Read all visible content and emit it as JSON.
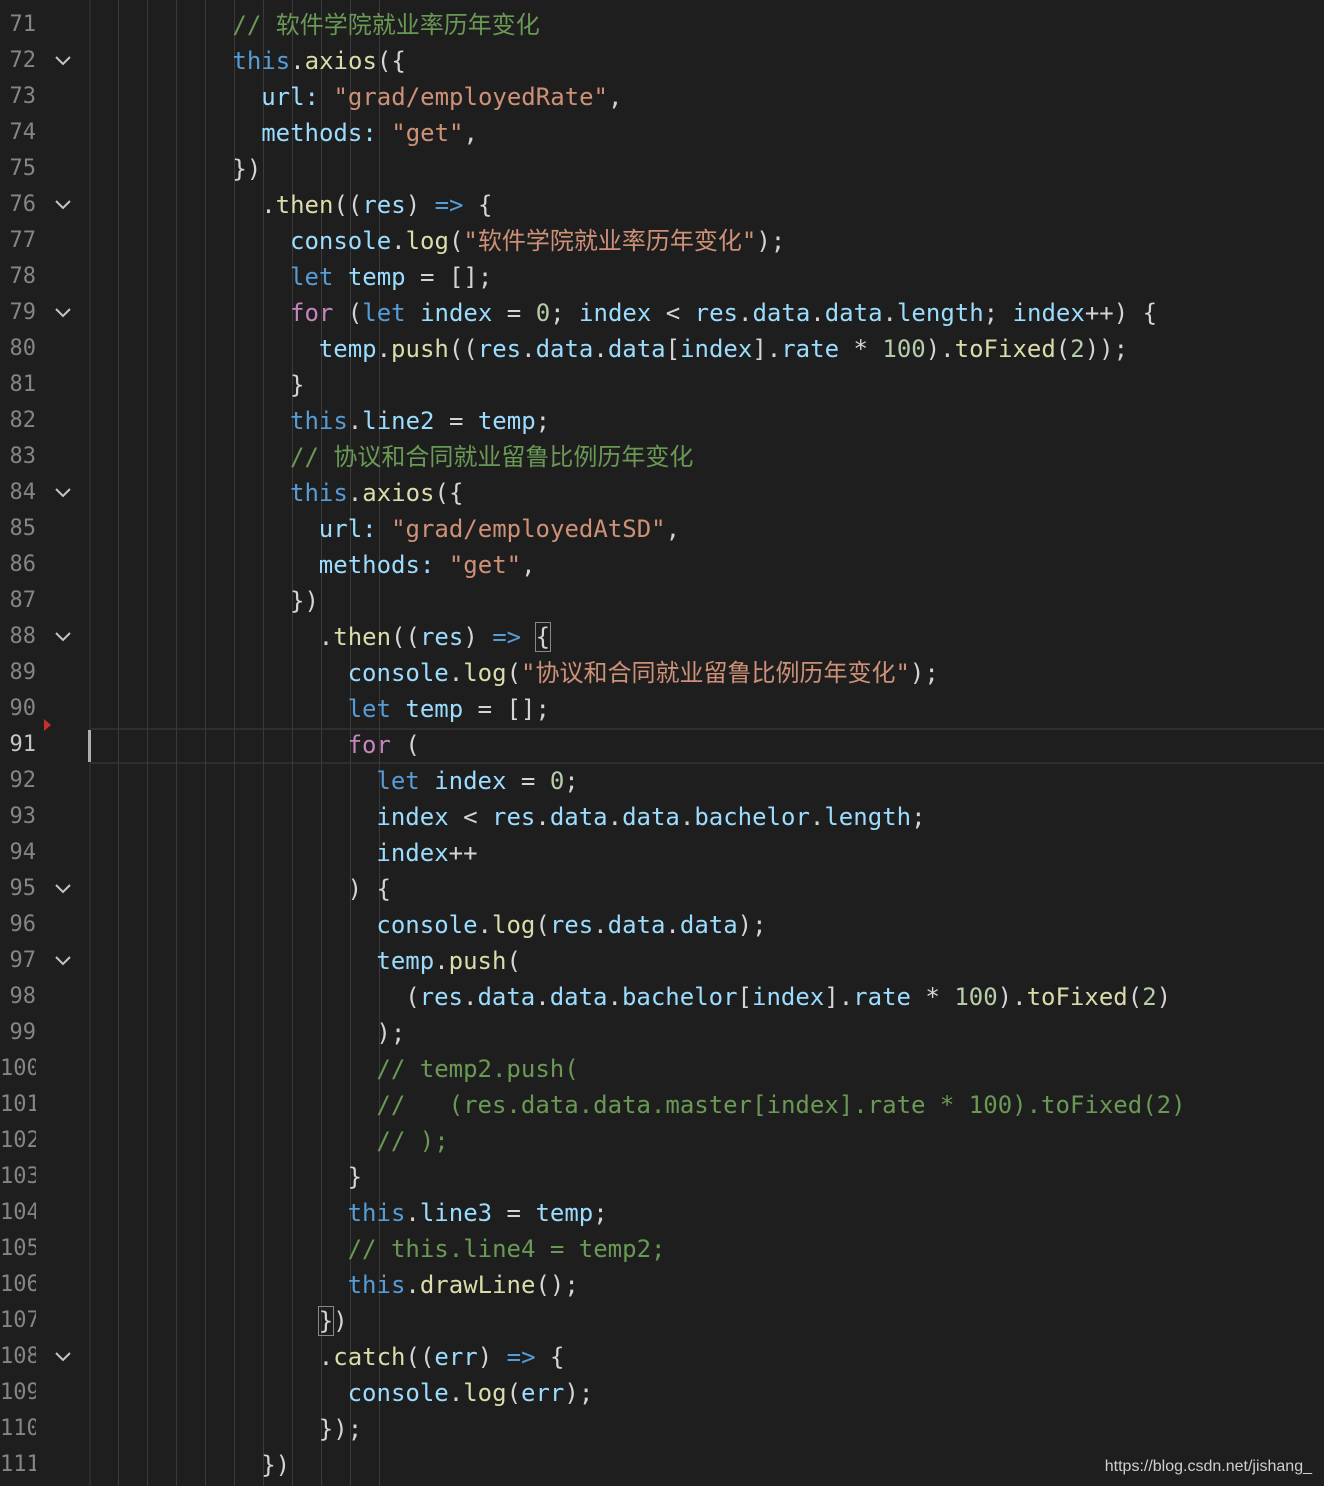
{
  "editor": {
    "active_line": "91",
    "lines": [
      {
        "number": "71",
        "fold": false,
        "indent": 8,
        "tokens": [
          {
            "t": "cmt",
            "v": "// 软件学院就业率历年变化"
          }
        ]
      },
      {
        "number": "72",
        "fold": true,
        "indent": 8,
        "tokens": [
          {
            "t": "kw",
            "v": "this"
          },
          {
            "t": "pun",
            "v": "."
          },
          {
            "t": "fn",
            "v": "axios"
          },
          {
            "t": "pun",
            "v": "({"
          }
        ]
      },
      {
        "number": "73",
        "fold": false,
        "indent": 9,
        "tokens": [
          {
            "t": "var",
            "v": "url"
          },
          {
            "t": "var",
            "v": ":"
          },
          {
            "t": "pun",
            "v": " "
          },
          {
            "t": "str",
            "v": "\"grad/employedRate\""
          },
          {
            "t": "pun",
            "v": ","
          }
        ]
      },
      {
        "number": "74",
        "fold": false,
        "indent": 9,
        "tokens": [
          {
            "t": "var",
            "v": "methods"
          },
          {
            "t": "var",
            "v": ":"
          },
          {
            "t": "pun",
            "v": " "
          },
          {
            "t": "str",
            "v": "\"get\""
          },
          {
            "t": "pun",
            "v": ","
          }
        ]
      },
      {
        "number": "75",
        "fold": false,
        "indent": 8,
        "tokens": [
          {
            "t": "pun",
            "v": "})"
          }
        ]
      },
      {
        "number": "76",
        "fold": true,
        "indent": 9,
        "tokens": [
          {
            "t": "pun",
            "v": "."
          },
          {
            "t": "fn",
            "v": "then"
          },
          {
            "t": "pun",
            "v": "(("
          },
          {
            "t": "var",
            "v": "res"
          },
          {
            "t": "pun",
            "v": ") "
          },
          {
            "t": "kw",
            "v": "=>"
          },
          {
            "t": "pun",
            "v": " {"
          }
        ]
      },
      {
        "number": "77",
        "fold": false,
        "indent": 10,
        "tokens": [
          {
            "t": "var",
            "v": "console"
          },
          {
            "t": "pun",
            "v": "."
          },
          {
            "t": "fn",
            "v": "log"
          },
          {
            "t": "pun",
            "v": "("
          },
          {
            "t": "str",
            "v": "\"软件学院就业率历年变化\""
          },
          {
            "t": "pun",
            "v": ");"
          }
        ]
      },
      {
        "number": "78",
        "fold": false,
        "indent": 10,
        "tokens": [
          {
            "t": "kw",
            "v": "let"
          },
          {
            "t": "pun",
            "v": " "
          },
          {
            "t": "var",
            "v": "temp"
          },
          {
            "t": "pun",
            "v": " = [];"
          }
        ]
      },
      {
        "number": "79",
        "fold": true,
        "indent": 10,
        "tokens": [
          {
            "t": "ctl",
            "v": "for"
          },
          {
            "t": "pun",
            "v": " ("
          },
          {
            "t": "kw",
            "v": "let"
          },
          {
            "t": "pun",
            "v": " "
          },
          {
            "t": "var",
            "v": "index"
          },
          {
            "t": "pun",
            "v": " = "
          },
          {
            "t": "num",
            "v": "0"
          },
          {
            "t": "pun",
            "v": "; "
          },
          {
            "t": "var",
            "v": "index"
          },
          {
            "t": "pun",
            "v": " < "
          },
          {
            "t": "var",
            "v": "res"
          },
          {
            "t": "pun",
            "v": "."
          },
          {
            "t": "var",
            "v": "data"
          },
          {
            "t": "pun",
            "v": "."
          },
          {
            "t": "var",
            "v": "data"
          },
          {
            "t": "pun",
            "v": "."
          },
          {
            "t": "var",
            "v": "length"
          },
          {
            "t": "pun",
            "v": "; "
          },
          {
            "t": "var",
            "v": "index"
          },
          {
            "t": "pun",
            "v": "++) {"
          }
        ]
      },
      {
        "number": "80",
        "fold": false,
        "indent": 11,
        "tokens": [
          {
            "t": "var",
            "v": "temp"
          },
          {
            "t": "pun",
            "v": "."
          },
          {
            "t": "fn",
            "v": "push"
          },
          {
            "t": "pun",
            "v": "(("
          },
          {
            "t": "var",
            "v": "res"
          },
          {
            "t": "pun",
            "v": "."
          },
          {
            "t": "var",
            "v": "data"
          },
          {
            "t": "pun",
            "v": "."
          },
          {
            "t": "var",
            "v": "data"
          },
          {
            "t": "pun",
            "v": "["
          },
          {
            "t": "var",
            "v": "index"
          },
          {
            "t": "pun",
            "v": "]."
          },
          {
            "t": "var",
            "v": "rate"
          },
          {
            "t": "pun",
            "v": " * "
          },
          {
            "t": "num",
            "v": "100"
          },
          {
            "t": "pun",
            "v": ")."
          },
          {
            "t": "fn",
            "v": "toFixed"
          },
          {
            "t": "pun",
            "v": "("
          },
          {
            "t": "num",
            "v": "2"
          },
          {
            "t": "pun",
            "v": "));"
          }
        ]
      },
      {
        "number": "81",
        "fold": false,
        "indent": 10,
        "tokens": [
          {
            "t": "pun",
            "v": "}"
          }
        ]
      },
      {
        "number": "82",
        "fold": false,
        "indent": 10,
        "tokens": [
          {
            "t": "kw",
            "v": "this"
          },
          {
            "t": "pun",
            "v": "."
          },
          {
            "t": "var",
            "v": "line2"
          },
          {
            "t": "pun",
            "v": " = "
          },
          {
            "t": "var",
            "v": "temp"
          },
          {
            "t": "pun",
            "v": ";"
          }
        ]
      },
      {
        "number": "83",
        "fold": false,
        "indent": 10,
        "tokens": [
          {
            "t": "cmt",
            "v": "// 协议和合同就业留鲁比例历年变化"
          }
        ]
      },
      {
        "number": "84",
        "fold": true,
        "indent": 10,
        "tokens": [
          {
            "t": "kw",
            "v": "this"
          },
          {
            "t": "pun",
            "v": "."
          },
          {
            "t": "fn",
            "v": "axios"
          },
          {
            "t": "pun",
            "v": "({"
          }
        ]
      },
      {
        "number": "85",
        "fold": false,
        "indent": 11,
        "tokens": [
          {
            "t": "var",
            "v": "url"
          },
          {
            "t": "var",
            "v": ":"
          },
          {
            "t": "pun",
            "v": " "
          },
          {
            "t": "str",
            "v": "\"grad/employedAtSD\""
          },
          {
            "t": "pun",
            "v": ","
          }
        ]
      },
      {
        "number": "86",
        "fold": false,
        "indent": 11,
        "tokens": [
          {
            "t": "var",
            "v": "methods"
          },
          {
            "t": "var",
            "v": ":"
          },
          {
            "t": "pun",
            "v": " "
          },
          {
            "t": "str",
            "v": "\"get\""
          },
          {
            "t": "pun",
            "v": ","
          }
        ]
      },
      {
        "number": "87",
        "fold": false,
        "indent": 10,
        "tokens": [
          {
            "t": "pun",
            "v": "})"
          }
        ]
      },
      {
        "number": "88",
        "fold": true,
        "indent": 11,
        "tokens": [
          {
            "t": "pun",
            "v": "."
          },
          {
            "t": "fn",
            "v": "then"
          },
          {
            "t": "pun",
            "v": "(("
          },
          {
            "t": "var",
            "v": "res"
          },
          {
            "t": "pun",
            "v": ") "
          },
          {
            "t": "kw",
            "v": "=>"
          },
          {
            "t": "pun",
            "v": " "
          },
          {
            "t": "bm",
            "v": "{"
          }
        ]
      },
      {
        "number": "89",
        "fold": false,
        "indent": 12,
        "tokens": [
          {
            "t": "var",
            "v": "console"
          },
          {
            "t": "pun",
            "v": "."
          },
          {
            "t": "fn",
            "v": "log"
          },
          {
            "t": "pun",
            "v": "("
          },
          {
            "t": "str",
            "v": "\"协议和合同就业留鲁比例历年变化\""
          },
          {
            "t": "pun",
            "v": ");"
          }
        ]
      },
      {
        "number": "90",
        "fold": false,
        "indent": 12,
        "tokens": [
          {
            "t": "kw",
            "v": "let"
          },
          {
            "t": "pun",
            "v": " "
          },
          {
            "t": "var",
            "v": "temp"
          },
          {
            "t": "pun",
            "v": " = [];"
          }
        ]
      },
      {
        "number": "91",
        "fold": false,
        "indent": 12,
        "tokens": [
          {
            "t": "ctl",
            "v": "for"
          },
          {
            "t": "pun",
            "v": " ("
          }
        ]
      },
      {
        "number": "92",
        "fold": false,
        "indent": 13,
        "tokens": [
          {
            "t": "kw",
            "v": "let"
          },
          {
            "t": "pun",
            "v": " "
          },
          {
            "t": "var",
            "v": "index"
          },
          {
            "t": "pun",
            "v": " = "
          },
          {
            "t": "num",
            "v": "0"
          },
          {
            "t": "pun",
            "v": ";"
          }
        ]
      },
      {
        "number": "93",
        "fold": false,
        "indent": 13,
        "tokens": [
          {
            "t": "var",
            "v": "index"
          },
          {
            "t": "pun",
            "v": " < "
          },
          {
            "t": "var",
            "v": "res"
          },
          {
            "t": "pun",
            "v": "."
          },
          {
            "t": "var",
            "v": "data"
          },
          {
            "t": "pun",
            "v": "."
          },
          {
            "t": "var",
            "v": "data"
          },
          {
            "t": "pun",
            "v": "."
          },
          {
            "t": "var",
            "v": "bachelor"
          },
          {
            "t": "pun",
            "v": "."
          },
          {
            "t": "var",
            "v": "length"
          },
          {
            "t": "pun",
            "v": ";"
          }
        ]
      },
      {
        "number": "94",
        "fold": false,
        "indent": 13,
        "tokens": [
          {
            "t": "var",
            "v": "index"
          },
          {
            "t": "pun",
            "v": "++"
          }
        ]
      },
      {
        "number": "95",
        "fold": true,
        "indent": 12,
        "tokens": [
          {
            "t": "pun",
            "v": ") {"
          }
        ]
      },
      {
        "number": "96",
        "fold": false,
        "indent": 13,
        "tokens": [
          {
            "t": "var",
            "v": "console"
          },
          {
            "t": "pun",
            "v": "."
          },
          {
            "t": "fn",
            "v": "log"
          },
          {
            "t": "pun",
            "v": "("
          },
          {
            "t": "var",
            "v": "res"
          },
          {
            "t": "pun",
            "v": "."
          },
          {
            "t": "var",
            "v": "data"
          },
          {
            "t": "pun",
            "v": "."
          },
          {
            "t": "var",
            "v": "data"
          },
          {
            "t": "pun",
            "v": ");"
          }
        ]
      },
      {
        "number": "97",
        "fold": true,
        "indent": 13,
        "tokens": [
          {
            "t": "var",
            "v": "temp"
          },
          {
            "t": "pun",
            "v": "."
          },
          {
            "t": "fn",
            "v": "push"
          },
          {
            "t": "pun",
            "v": "("
          }
        ]
      },
      {
        "number": "98",
        "fold": false,
        "indent": 14,
        "tokens": [
          {
            "t": "pun",
            "v": "("
          },
          {
            "t": "var",
            "v": "res"
          },
          {
            "t": "pun",
            "v": "."
          },
          {
            "t": "var",
            "v": "data"
          },
          {
            "t": "pun",
            "v": "."
          },
          {
            "t": "var",
            "v": "data"
          },
          {
            "t": "pun",
            "v": "."
          },
          {
            "t": "var",
            "v": "bachelor"
          },
          {
            "t": "pun",
            "v": "["
          },
          {
            "t": "var",
            "v": "index"
          },
          {
            "t": "pun",
            "v": "]."
          },
          {
            "t": "var",
            "v": "rate"
          },
          {
            "t": "pun",
            "v": " * "
          },
          {
            "t": "num",
            "v": "100"
          },
          {
            "t": "pun",
            "v": ")."
          },
          {
            "t": "fn",
            "v": "toFixed"
          },
          {
            "t": "pun",
            "v": "("
          },
          {
            "t": "num",
            "v": "2"
          },
          {
            "t": "pun",
            "v": ")"
          }
        ]
      },
      {
        "number": "99",
        "fold": false,
        "indent": 13,
        "tokens": [
          {
            "t": "pun",
            "v": ");"
          }
        ]
      },
      {
        "number": "100",
        "fold": false,
        "indent": 13,
        "tokens": [
          {
            "t": "cmt",
            "v": "// temp2.push("
          }
        ]
      },
      {
        "number": "101",
        "fold": false,
        "indent": 13,
        "tokens": [
          {
            "t": "cmt",
            "v": "//   (res.data.data.master[index].rate * 100).toFixed(2)"
          }
        ]
      },
      {
        "number": "102",
        "fold": false,
        "indent": 13,
        "tokens": [
          {
            "t": "cmt",
            "v": "// );"
          }
        ]
      },
      {
        "number": "103",
        "fold": false,
        "indent": 12,
        "tokens": [
          {
            "t": "pun",
            "v": "}"
          }
        ]
      },
      {
        "number": "104",
        "fold": false,
        "indent": 12,
        "tokens": [
          {
            "t": "kw",
            "v": "this"
          },
          {
            "t": "pun",
            "v": "."
          },
          {
            "t": "var",
            "v": "line3"
          },
          {
            "t": "pun",
            "v": " = "
          },
          {
            "t": "var",
            "v": "temp"
          },
          {
            "t": "pun",
            "v": ";"
          }
        ]
      },
      {
        "number": "105",
        "fold": false,
        "indent": 12,
        "tokens": [
          {
            "t": "cmt",
            "v": "// this.line4 = temp2;"
          }
        ]
      },
      {
        "number": "106",
        "fold": false,
        "indent": 12,
        "tokens": [
          {
            "t": "kw",
            "v": "this"
          },
          {
            "t": "pun",
            "v": "."
          },
          {
            "t": "fn",
            "v": "drawLine"
          },
          {
            "t": "pun",
            "v": "();"
          }
        ]
      },
      {
        "number": "107",
        "fold": false,
        "indent": 11,
        "tokens": [
          {
            "t": "bm",
            "v": "}"
          },
          {
            "t": "pun",
            "v": ")"
          }
        ]
      },
      {
        "number": "108",
        "fold": true,
        "indent": 11,
        "tokens": [
          {
            "t": "pun",
            "v": "."
          },
          {
            "t": "fn",
            "v": "catch"
          },
          {
            "t": "pun",
            "v": "(("
          },
          {
            "t": "var",
            "v": "err"
          },
          {
            "t": "pun",
            "v": ") "
          },
          {
            "t": "kw",
            "v": "=>"
          },
          {
            "t": "pun",
            "v": " {"
          }
        ]
      },
      {
        "number": "109",
        "fold": false,
        "indent": 12,
        "tokens": [
          {
            "t": "var",
            "v": "console"
          },
          {
            "t": "pun",
            "v": "."
          },
          {
            "t": "fn",
            "v": "log"
          },
          {
            "t": "pun",
            "v": "("
          },
          {
            "t": "var",
            "v": "err"
          },
          {
            "t": "pun",
            "v": ");"
          }
        ]
      },
      {
        "number": "110",
        "fold": false,
        "indent": 11,
        "tokens": [
          {
            "t": "pun",
            "v": "});"
          }
        ]
      },
      {
        "number": "111",
        "fold": false,
        "indent": 9,
        "tokens": [
          {
            "t": "pun",
            "v": "})"
          }
        ]
      }
    ]
  },
  "watermark": "https://blog.csdn.net/jishang_",
  "colors": {
    "background": "#1e1e1e",
    "keyword": "#569cd6",
    "control": "#c586c0",
    "variable": "#9cdcfe",
    "function": "#dcdcaa",
    "string": "#ce9178",
    "number": "#b5cea8",
    "comment": "#6a9955",
    "breakpoint": "#c72e2e"
  },
  "icons": {
    "fold": "chevron-down-icon",
    "breakpoint": "breakpoint-arrow-icon"
  }
}
